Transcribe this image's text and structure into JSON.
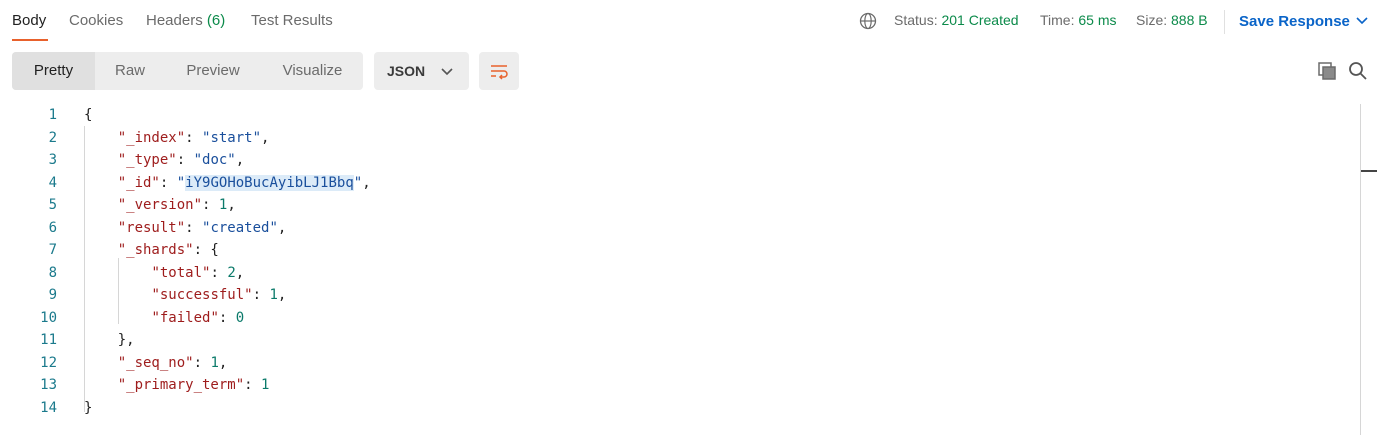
{
  "tabs": [
    {
      "label": "Body",
      "count": ""
    },
    {
      "label": "Cookies",
      "count": ""
    },
    {
      "label": "Headers",
      "count": "(6)"
    },
    {
      "label": "Test Results",
      "count": ""
    }
  ],
  "status": {
    "status_label": "Status:",
    "status_value": "201 Created",
    "time_label": "Time:",
    "time_value": "65 ms",
    "size_label": "Size:",
    "size_value": "888 B"
  },
  "save_response": "Save Response",
  "view_modes": [
    "Pretty",
    "Raw",
    "Preview",
    "Visualize"
  ],
  "format": "JSON",
  "icons": {
    "globe": "globe-icon",
    "chevron": "chevron-down-icon",
    "wrap": "wrap-lines-icon",
    "copy": "copy-icon",
    "search": "search-icon"
  },
  "colors": {
    "accent": "#e8612c",
    "success": "#0b8a4a",
    "link": "#0a64c8"
  },
  "code_lines": [
    {
      "n": "1",
      "tokens": [
        {
          "t": "{",
          "c": "p"
        }
      ]
    },
    {
      "n": "2",
      "tokens": [
        {
          "t": "    ",
          "c": "p"
        },
        {
          "t": "\"_index\"",
          "c": "k"
        },
        {
          "t": ": ",
          "c": "p"
        },
        {
          "t": "\"start\"",
          "c": "s"
        },
        {
          "t": ",",
          "c": "p"
        }
      ]
    },
    {
      "n": "3",
      "tokens": [
        {
          "t": "    ",
          "c": "p"
        },
        {
          "t": "\"_type\"",
          "c": "k"
        },
        {
          "t": ": ",
          "c": "p"
        },
        {
          "t": "\"doc\"",
          "c": "s"
        },
        {
          "t": ",",
          "c": "p"
        }
      ]
    },
    {
      "n": "4",
      "tokens": [
        {
          "t": "    ",
          "c": "p"
        },
        {
          "t": "\"_id\"",
          "c": "k"
        },
        {
          "t": ": ",
          "c": "p"
        },
        {
          "t": "\"",
          "c": "s"
        },
        {
          "t": "iY9GOHoBucAyibLJ1Bbq",
          "c": "s hl"
        },
        {
          "t": "\"",
          "c": "s"
        },
        {
          "t": ",",
          "c": "p"
        }
      ]
    },
    {
      "n": "5",
      "tokens": [
        {
          "t": "    ",
          "c": "p"
        },
        {
          "t": "\"_version\"",
          "c": "k"
        },
        {
          "t": ": ",
          "c": "p"
        },
        {
          "t": "1",
          "c": "n"
        },
        {
          "t": ",",
          "c": "p"
        }
      ]
    },
    {
      "n": "6",
      "tokens": [
        {
          "t": "    ",
          "c": "p"
        },
        {
          "t": "\"result\"",
          "c": "k"
        },
        {
          "t": ": ",
          "c": "p"
        },
        {
          "t": "\"created\"",
          "c": "s"
        },
        {
          "t": ",",
          "c": "p"
        }
      ]
    },
    {
      "n": "7",
      "tokens": [
        {
          "t": "    ",
          "c": "p"
        },
        {
          "t": "\"_shards\"",
          "c": "k"
        },
        {
          "t": ": {",
          "c": "p"
        }
      ]
    },
    {
      "n": "8",
      "tokens": [
        {
          "t": "        ",
          "c": "p"
        },
        {
          "t": "\"total\"",
          "c": "k"
        },
        {
          "t": ": ",
          "c": "p"
        },
        {
          "t": "2",
          "c": "n"
        },
        {
          "t": ",",
          "c": "p"
        }
      ]
    },
    {
      "n": "9",
      "tokens": [
        {
          "t": "        ",
          "c": "p"
        },
        {
          "t": "\"successful\"",
          "c": "k"
        },
        {
          "t": ": ",
          "c": "p"
        },
        {
          "t": "1",
          "c": "n"
        },
        {
          "t": ",",
          "c": "p"
        }
      ]
    },
    {
      "n": "10",
      "tokens": [
        {
          "t": "        ",
          "c": "p"
        },
        {
          "t": "\"failed\"",
          "c": "k"
        },
        {
          "t": ": ",
          "c": "p"
        },
        {
          "t": "0",
          "c": "n"
        }
      ]
    },
    {
      "n": "11",
      "tokens": [
        {
          "t": "    },",
          "c": "p"
        }
      ]
    },
    {
      "n": "12",
      "tokens": [
        {
          "t": "    ",
          "c": "p"
        },
        {
          "t": "\"_seq_no\"",
          "c": "k"
        },
        {
          "t": ": ",
          "c": "p"
        },
        {
          "t": "1",
          "c": "n"
        },
        {
          "t": ",",
          "c": "p"
        }
      ]
    },
    {
      "n": "13",
      "tokens": [
        {
          "t": "    ",
          "c": "p"
        },
        {
          "t": "\"_primary_term\"",
          "c": "k"
        },
        {
          "t": ": ",
          "c": "p"
        },
        {
          "t": "1",
          "c": "n"
        }
      ]
    },
    {
      "n": "14",
      "tokens": [
        {
          "t": "}",
          "c": "p"
        }
      ]
    }
  ]
}
